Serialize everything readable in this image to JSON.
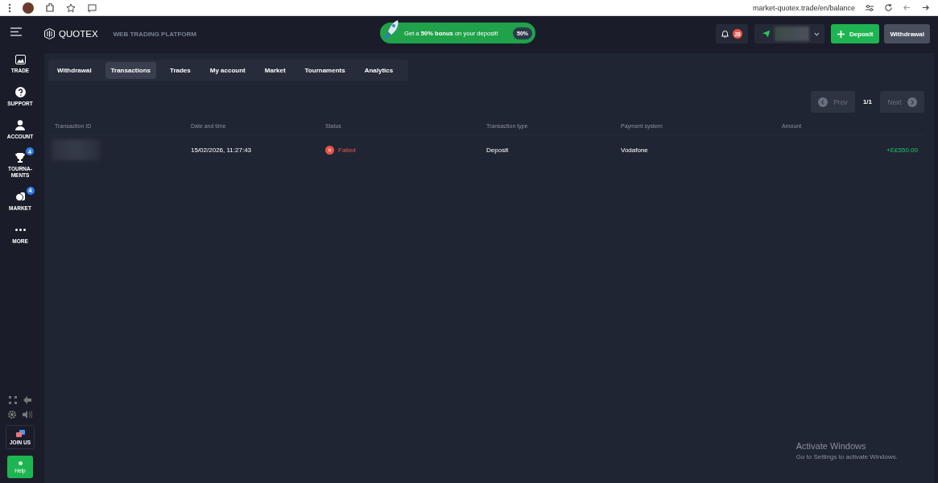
{
  "browser": {
    "url": "market-quotex.trade/en/balance"
  },
  "header": {
    "logo": "QUOTEX",
    "subtitle": "WEB TRADING PLATFORM",
    "promo": {
      "text": "Get a **50% bonus** on your deposit!",
      "badge": "50%"
    },
    "notifications": {
      "count": "28"
    },
    "deposit": "Deposit",
    "withdrawal": "Withdrawal"
  },
  "sidebar": {
    "items": [
      {
        "kind": "trade",
        "label": "TRADE"
      },
      {
        "kind": "support",
        "label": "SUPPORT"
      },
      {
        "kind": "account",
        "label": "ACCOUNT"
      },
      {
        "kind": "tournaments",
        "label": "TOURNA-MENTS",
        "badge": "4"
      },
      {
        "kind": "market",
        "label": "MARKET",
        "badge": "4"
      },
      {
        "kind": "more",
        "label": "MORE"
      }
    ],
    "join_us": "JOIN US",
    "help": "Help"
  },
  "tabs": [
    {
      "label": "Withdrawal",
      "selected": false
    },
    {
      "label": "Transactions",
      "selected": true
    },
    {
      "label": "Trades",
      "selected": false
    },
    {
      "label": "My account",
      "selected": false
    },
    {
      "label": "Market",
      "selected": false
    },
    {
      "label": "Tournaments",
      "selected": false
    },
    {
      "label": "Analytics",
      "selected": false
    }
  ],
  "pagination": {
    "prev": {
      "label": "Prev",
      "disabled": true
    },
    "page": "1/1",
    "next": {
      "label": "Next",
      "disabled": true
    }
  },
  "table": {
    "columns": [
      "Transaction ID",
      "Date and time",
      "Status",
      "Transaction type",
      "Payment system",
      "Amount"
    ],
    "rows": [
      {
        "date": "15/02/2026, 11:27:43",
        "status": {
          "kind": "failed",
          "text": "Failed"
        },
        "type": "Deposit",
        "payment": "Vodafone",
        "amount": "+E£550.00"
      }
    ]
  },
  "os_notice": {
    "title": "Activate Windows",
    "text": "Go to Settings to activate Windows."
  }
}
